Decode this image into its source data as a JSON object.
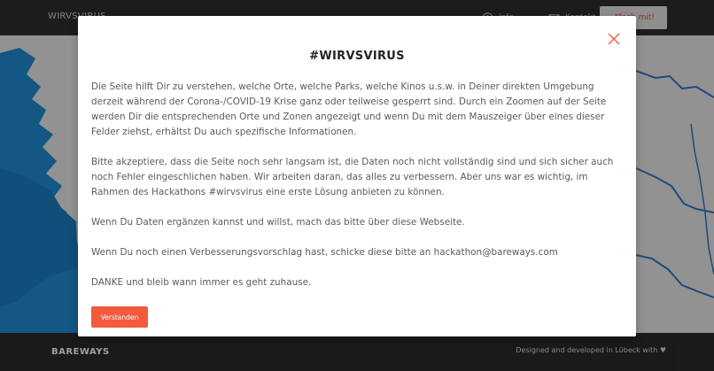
{
  "header": {
    "brand": "WIRVSVIRUS",
    "nav_info": "Info",
    "nav_contact": "Kontakt",
    "join_label": "Mach mit!"
  },
  "modal": {
    "title": "#WIRVSVIRUS",
    "paragraphs": [
      "Die Seite hilft Dir zu verstehen, welche Orte, welche Parks, welche Kinos u.s.w. in Deiner direkten Umgebung derzeit während der Corona-/COVID-19 Krise ganz oder teilweise gesperrt sind. Durch ein Zoomen auf der Seite werden Dir die entsprechenden Orte und Zonen angezeigt und wenn Du mit dem Mauszeiger über eines dieser Felder ziehst, erhältst Du auch spezifische Informationen.",
      "Bitte akzeptiere, dass die Seite noch sehr langsam ist, die Daten noch nicht vollständig sind und sich sicher auch noch Fehler eingeschlichen haben. Wir arbeiten daran, das alles zu verbessern. Aber uns war es wichtig, im Rahmen des Hackathons #wirvsvirus eine erste Lösung anbieten zu können.",
      "Wenn Du Daten ergänzen kannst und willst, mach das bitte über diese Webseite.",
      "Wenn Du noch einen Verbesserungsvorschlag hast, schicke diese bitte an hackathon@bareways.com",
      "DANKE und bleib wann immer es geht zuhause."
    ],
    "confirm_label": "Verstanden"
  },
  "footer": {
    "logo": "BAREWAYS",
    "credit": "Designed and developed in Lübeck with ♥"
  },
  "colors": {
    "accent": "#f15a3b",
    "water": "#1f8dd6",
    "border_line": "#2b79c8",
    "land": "#ececec",
    "header_bg": "#2e2e2e"
  },
  "icons": {
    "close": "close-icon",
    "info": "info-icon",
    "mail": "mail-icon",
    "join": "pencil-icon"
  }
}
